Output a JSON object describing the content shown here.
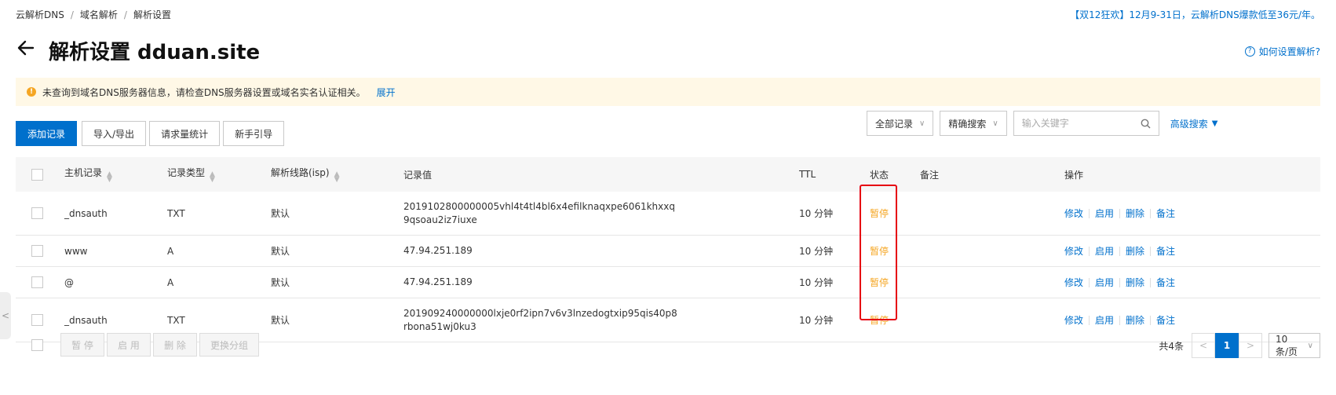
{
  "breadcrumb": [
    "云解析DNS",
    "域名解析",
    "解析设置"
  ],
  "promo": "【双12狂欢】12月9-31日，云解析DNS爆款低至36元/年。",
  "page_title": "解析设置 dduan.site",
  "help_link": "如何设置解析?",
  "notice": {
    "text": "未查询到域名DNS服务器信息，请检查DNS服务器设置或域名实名认证相关。",
    "link": "展开"
  },
  "toolbar": {
    "add": "添加记录",
    "import_export": "导入/导出",
    "stats": "请求量统计",
    "guide": "新手引导"
  },
  "filters": {
    "all_records": "全部记录",
    "exact_search": "精确搜索",
    "search_placeholder": "输入关键字",
    "advanced": "高级搜索"
  },
  "columns": {
    "host": "主机记录",
    "type": "记录类型",
    "line": "解析线路(isp)",
    "value": "记录值",
    "ttl": "TTL",
    "status": "状态",
    "remark": "备注",
    "ops": "操作"
  },
  "rows": [
    {
      "host": "_dnsauth",
      "type": "TXT",
      "line": "默认",
      "value1": "2019102800000005vhl4t4tl4bl6x4efilknaqxpe6061khxxq",
      "value2": "9qsoau2iz7iuxe",
      "ttl": "10 分钟",
      "status": "暂停"
    },
    {
      "host": "www",
      "type": "A",
      "line": "默认",
      "value1": "47.94.251.189",
      "value2": "",
      "ttl": "10 分钟",
      "status": "暂停"
    },
    {
      "host": "@",
      "type": "A",
      "line": "默认",
      "value1": "47.94.251.189",
      "value2": "",
      "ttl": "10 分钟",
      "status": "暂停"
    },
    {
      "host": "_dnsauth",
      "type": "TXT",
      "line": "默认",
      "value1": "201909240000000lxje0rf2ipn7v6v3lnzedogtxip95qis40p8",
      "value2": "rbona51wj0ku3",
      "ttl": "10 分钟",
      "status": "暂停"
    }
  ],
  "row_ops": {
    "edit": "修改",
    "enable": "启用",
    "delete": "删除",
    "remark": "备注"
  },
  "bulk": {
    "pause": "暂 停",
    "enable": "启 用",
    "delete": "删 除",
    "change_group": "更换分组"
  },
  "pagination": {
    "total": "共4条",
    "prev": "<",
    "current": "1",
    "next": ">",
    "page_size": "10 条/页"
  },
  "side_tab": "<",
  "colors": {
    "accent": "#0070cc",
    "status_paused": "#f5a623",
    "highlight": "#e60012"
  }
}
